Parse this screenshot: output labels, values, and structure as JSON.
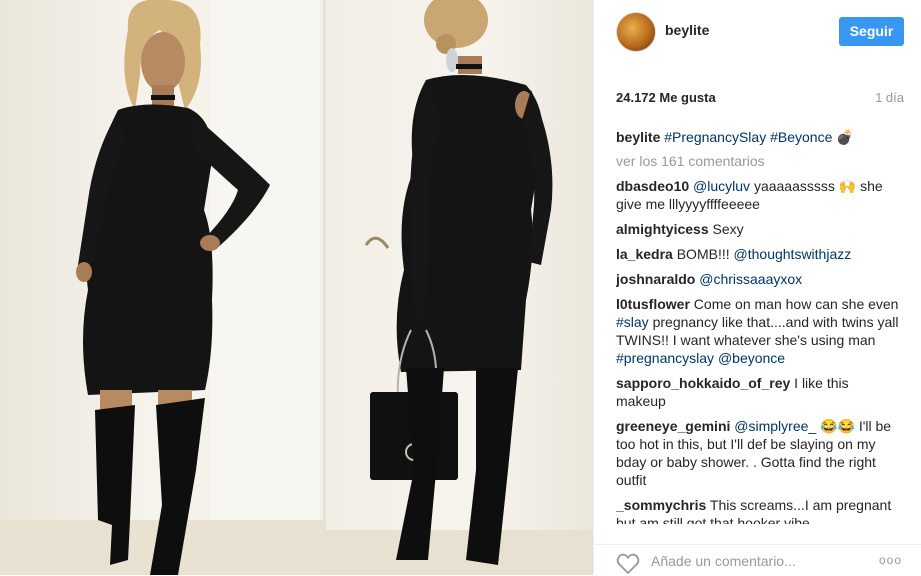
{
  "post": {
    "username": "beylite",
    "follow_label": "Seguir",
    "likes": "24.172 Me gusta",
    "time": "1 día"
  },
  "caption": {
    "username": "beylite",
    "tag1": "#PregnancySlay",
    "tag2": "#Beyonce",
    "emoji": "💣"
  },
  "view_all": "ver los 161 comentarios",
  "comments": [
    {
      "user": "dbasdeo10",
      "mention": "@lucyluv",
      "text": "yaaaaasssss 🙌 she give me lllyyyyffffeeeee"
    },
    {
      "user": "almightyicess",
      "text": "Sexy"
    },
    {
      "user": "la_kedra",
      "text": "BOMB!!!",
      "mention": "@thoughtswithjazz"
    },
    {
      "user": "joshnaraldo",
      "mention": "@chrissaaayxox"
    },
    {
      "user": "l0tusflower",
      "text_a": "Come on man how can she even",
      "tag": "#slay",
      "text_b": "pregnancy like that....and with twins yall TWINS!! I want whatever she's using man",
      "tag2": "#pregnancyslay",
      "mention": "@beyonce"
    },
    {
      "user": "sapporo_hokkaido_of_rey",
      "text": "I like this makeup"
    },
    {
      "user": "greeneye_gemini",
      "mention": "@simplyree_",
      "text": "😂😂 I'll be too hot in this, but I'll def be slaying on my bday or baby shower. . Gotta find the right outfit"
    },
    {
      "user": "_sommychris",
      "text": "This screams...I am pregnant but am still got that hooker vibe"
    }
  ],
  "footer": {
    "placeholder": "Añade un comentario...",
    "more": "ooo"
  },
  "icons": {
    "heart": "heart-outline-icon",
    "more": "more-options-icon"
  },
  "colors": {
    "follow_button": "#3897f0",
    "link": "#003569",
    "muted": "#999999"
  }
}
